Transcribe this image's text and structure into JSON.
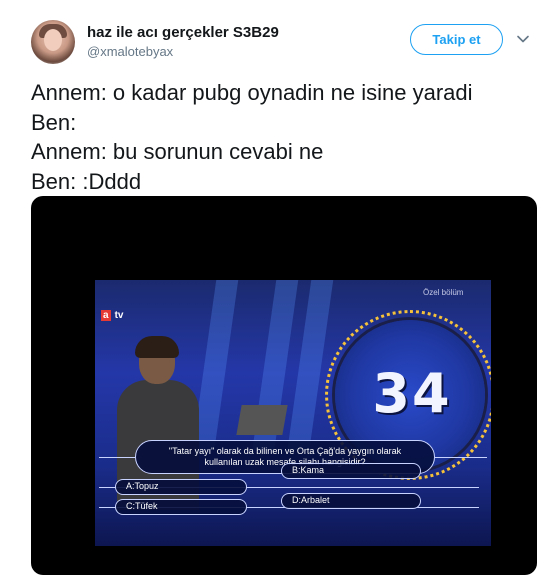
{
  "author": {
    "display_name": "haz ile acı gerçekler S3B29",
    "handle": "@xmalotebyax"
  },
  "follow_button_label": "Takip et",
  "tweet_lines": [
    "Annem: o kadar pubg oynadin ne isine yaradi",
    "Ben:",
    "Annem: bu sorunun cevabi ne",
    "Ben: :Dddd"
  ],
  "media": {
    "overlay_label": "Özel bölüm",
    "logo_text": "a",
    "logo_suffix": "tv",
    "question_number": "34",
    "question": "\"Tatar yayı\" olarak da bilinen ve Orta Çağ'da yaygın olarak kullanılan uzak mesafe silahı hangisidir?",
    "answers": [
      "A:Topuz",
      "B:Kama",
      "C:Tüfek",
      "D:Arbalet"
    ]
  },
  "colors": {
    "accent": "#1da1f2",
    "text": "#14171a",
    "muted": "#657786"
  },
  "icons": {
    "caret": "chevron-down-icon",
    "avatar": "profile-photo"
  }
}
